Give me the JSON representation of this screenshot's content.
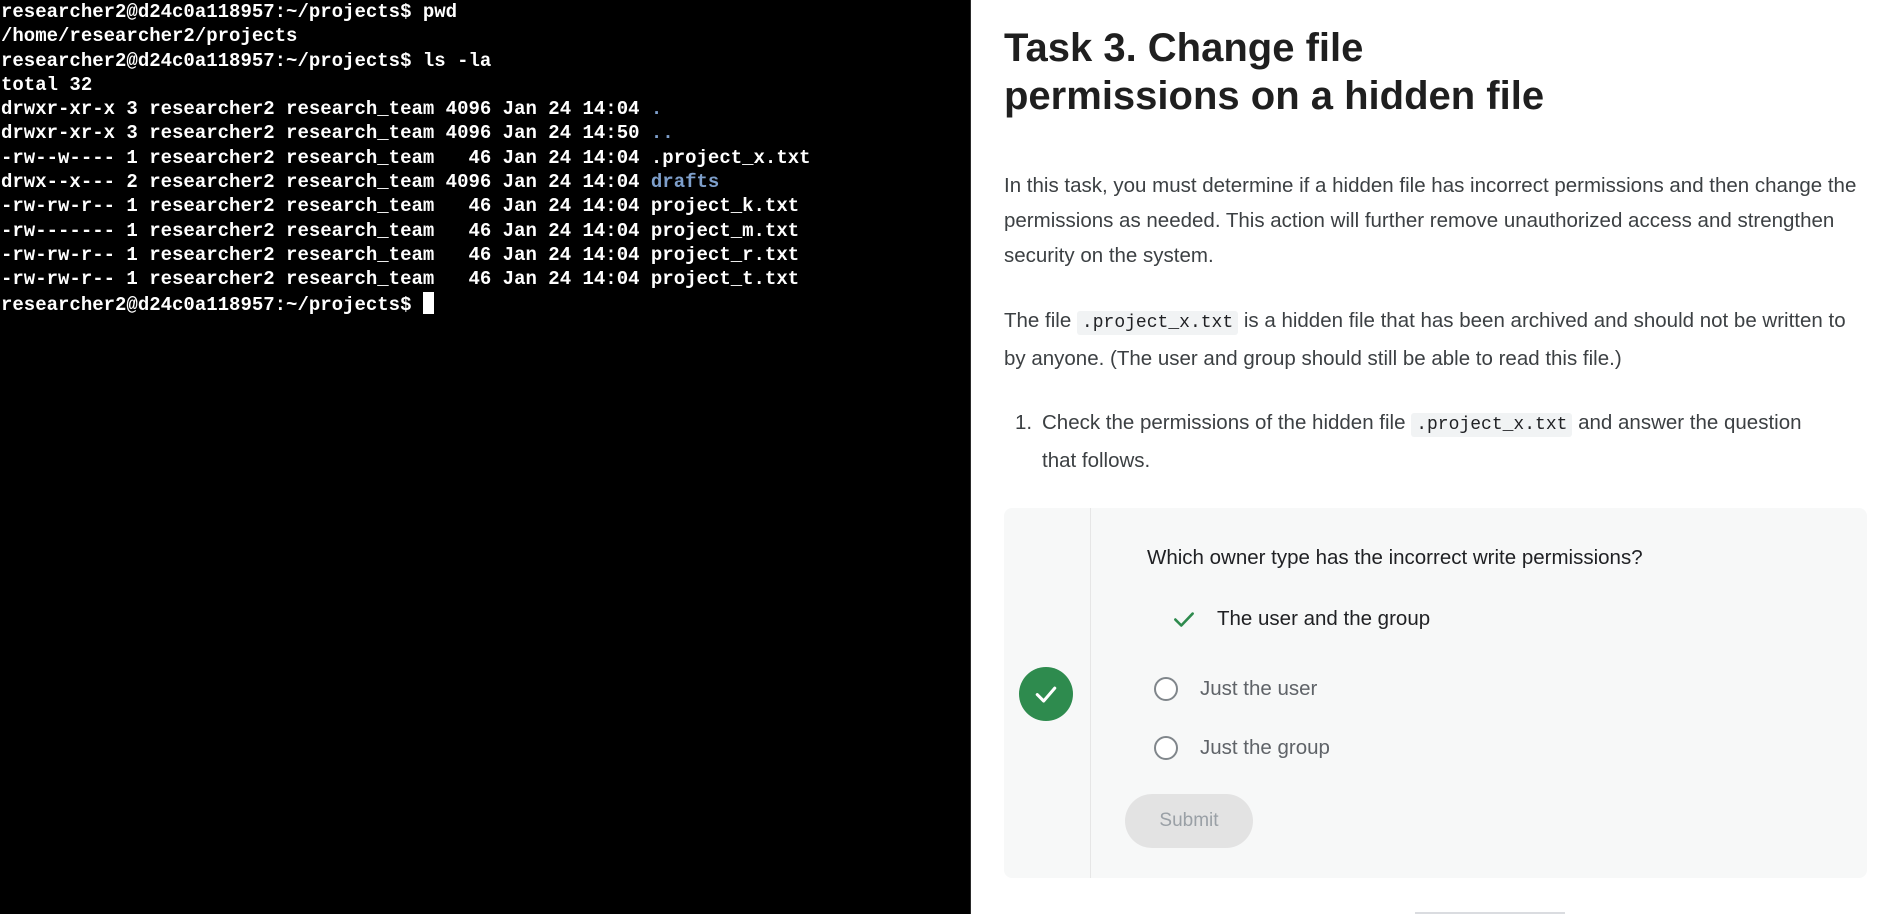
{
  "terminal": {
    "lines": [
      "researcher2@d24c0a118957:~/projects$ pwd",
      "/home/researcher2/projects",
      "researcher2@d24c0a118957:~/projects$ ls -la",
      "total 32"
    ],
    "listing": [
      {
        "prefix": "drwxr-xr-x 3 researcher2 research_team 4096 Jan 24 14:04 ",
        "name": "."
      },
      {
        "prefix": "drwxr-xr-x 3 researcher2 research_team 4096 Jan 24 14:50 ",
        "name": ".."
      },
      {
        "prefix": "-rw--w---- 1 researcher2 research_team   46 Jan 24 14:04 ",
        "name": ".project_x.txt"
      },
      {
        "prefix": "drwx--x--- 2 researcher2 research_team 4096 Jan 24 14:04 ",
        "name": "drafts"
      },
      {
        "prefix": "-rw-rw-r-- 1 researcher2 research_team   46 Jan 24 14:04 ",
        "name": "project_k.txt"
      },
      {
        "prefix": "-rw------- 1 researcher2 research_team   46 Jan 24 14:04 ",
        "name": "project_m.txt"
      },
      {
        "prefix": "-rw-rw-r-- 1 researcher2 research_team   46 Jan 24 14:04 ",
        "name": "project_r.txt"
      },
      {
        "prefix": "-rw-rw-r-- 1 researcher2 research_team   46 Jan 24 14:04 ",
        "name": "project_t.txt"
      }
    ],
    "prompt": "researcher2@d24c0a118957:~/projects$ "
  },
  "lesson": {
    "title": "Task 3. Change file permissions on a hidden file",
    "para1": "In this task, you must determine if a hidden file has incorrect permissions and then change the permissions as needed. This action will further remove unauthorized access and strengthen security on the system.",
    "para2_before": "The file ",
    "para2_code": ".project_x.txt",
    "para2_after": " is a hidden file that has been archived and should not be written to by anyone. (The user and group should still be able to read this file.)",
    "step_number": "1.",
    "step_before": "Check the permissions of the hidden file ",
    "step_code": ".project_x.txt",
    "step_after": " and answer the question that follows."
  },
  "quiz": {
    "question": "Which owner type has the incorrect write permissions?",
    "options": [
      {
        "label": "The user and the group",
        "state": "correct"
      },
      {
        "label": "Just the user",
        "state": "unselected"
      },
      {
        "label": "Just the group",
        "state": "unselected"
      }
    ],
    "submit_label": "Submit"
  },
  "colors": {
    "terminal_bg": "#000000",
    "directory_text": "#7e9fcb",
    "success_green": "#2e8b4e",
    "submit_disabled_bg": "#e3e3e3"
  },
  "icons": [
    "check-icon",
    "checkmark-badge-icon",
    "radio-empty-icon"
  ]
}
